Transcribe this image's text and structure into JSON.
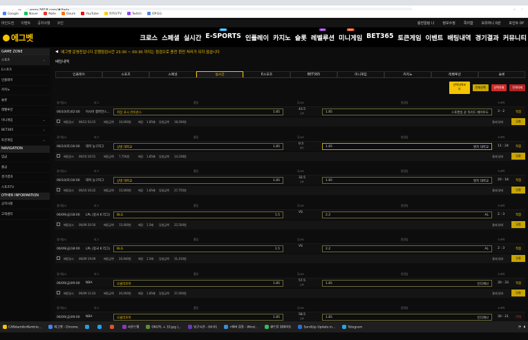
{
  "browser": {
    "url": "eggs-3818.com/#/bets",
    "bookmarks": [
      "Google",
      "Naver",
      "Nate",
      "Daum",
      "YouTube",
      "카카오TV",
      "Twitch",
      "OP.GG"
    ]
  },
  "topbar": {
    "left": [
      "마인드컨",
      "이벤트",
      "공지사항",
      "코인"
    ],
    "right": [
      "충전알림 나",
      "정보수정",
      "쪽지함",
      "보유머니 0원",
      "포인트 0P"
    ]
  },
  "header": {
    "logo": "에그벳",
    "nav": [
      {
        "label": "크로스",
        "badge": ""
      },
      {
        "label": "스페셜",
        "badge": ""
      },
      {
        "label": "실시간",
        "badge": ""
      },
      {
        "label": "E-SPORTS",
        "badge": "NEW"
      },
      {
        "label": "인플레이",
        "badge": ""
      },
      {
        "label": "카지노",
        "badge": ""
      },
      {
        "label": "슬롯",
        "badge": ""
      },
      {
        "label": "레벨루션",
        "badge": "HOT"
      },
      {
        "label": "미니게임",
        "badge": "HOT"
      },
      {
        "label": "BET365",
        "badge": ""
      },
      {
        "label": "토큰게임",
        "badge": ""
      },
      {
        "label": "이벤트",
        "badge": ""
      },
      {
        "label": "배팅내역",
        "badge": ""
      },
      {
        "label": "경기결과",
        "badge": ""
      },
      {
        "label": "커뮤니티",
        "badge": ""
      }
    ]
  },
  "sidebar": {
    "game_zone": "GAME ZONE",
    "games": [
      {
        "label": "스포츠",
        "arrow": "⌄"
      },
      {
        "label": "E스포츠",
        "arrow": ""
      },
      {
        "label": "인플레이",
        "arrow": ""
      },
      {
        "label": "카지노",
        "arrow": ""
      },
      {
        "label": "슬롯",
        "arrow": ""
      },
      {
        "label": "레벨루션",
        "arrow": ""
      },
      {
        "label": "미니게임",
        "arrow": "⌄"
      },
      {
        "label": "BET365",
        "arrow": "⌄"
      },
      {
        "label": "토큰게임",
        "arrow": "⌄"
      }
    ],
    "navigation": "NAVIGATION",
    "nav_items": [
      "입금",
      "출금",
      "경기결과",
      "스포츠TV"
    ],
    "other": "OTHER INFORMATION",
    "other_items": [
      "공지사항",
      "고객센터"
    ]
  },
  "notice": "에그벳 운영진입니다 은행점검시간 23:30 ~ 00:30 까지는 점검으로 충전 환전 처리가 되지 않습니다",
  "page_title": "배팅내역",
  "subtabs": [
    "인플레이",
    "스포츠",
    "스페셜",
    "실시간",
    "E스포츠",
    "BET365",
    "미니게임",
    "카지노",
    "레벨루션",
    "슬롯"
  ],
  "active_subtab": 3,
  "actions": [
    "선택내역보 부",
    "전체선택",
    "선택삭제",
    "전체삭제"
  ],
  "headers": {
    "time": "경기일시",
    "league": "리그",
    "home": "홈팀",
    "vs": "무/VS",
    "away": "원정팀",
    "score": "스코어"
  },
  "footer_labels": {
    "bet_time": "배팅일시",
    "bet_amount": "배팅금액",
    "odds": "배당",
    "win_amount": "당첨금액",
    "result": "결과/상태",
    "action": "당첨"
  },
  "bets": [
    {
      "time": "06/10(토)02:00",
      "league": "아시아 챔피언스...",
      "home": "저장 포시 라이온스",
      "home_odds": "1.85",
      "vs": "43.5",
      "vs_sub": "오버",
      "away_odds": "1.85",
      "away": "스포캔일 윤 타이드 베이투도",
      "score": "3 : 2",
      "result": "적중",
      "bet_time": "06/12 03:15",
      "amount": "10,000원",
      "odds": "1.85배",
      "win": "18,500원",
      "status": "결과/상태",
      "btn": "당첨"
    },
    {
      "time": "06/10(토)16:00",
      "league": "대학 농구리그",
      "home": "상명 대학교",
      "home_odds": "1.85",
      "vs": "0.5",
      "vs_sub": "핸디",
      "away_odds": "1.85",
      "away": "명지 대학교",
      "score": "11 : 24",
      "result": "적중",
      "bet_time": "06/10 16:51",
      "amount": "7,750원",
      "odds": "1.85배",
      "win": "14,338원",
      "status": "결과/상태",
      "btn": "당첨"
    },
    {
      "time": "06/10(토)16:00",
      "league": "대학 농구리그",
      "home": "상명 대학교",
      "home_odds": "1.85",
      "vs": "32.5",
      "vs_sub": "오버",
      "away_odds": "1.85",
      "away": "명지 대학교",
      "score": "20 : 18",
      "result": "적중",
      "bet_time": "06/10 16:22",
      "amount": "15,000원",
      "odds": "1.85배",
      "win": "27,750원",
      "status": "결과/상태",
      "btn": "당첨"
    },
    {
      "time": "06/09(금)18:00",
      "league": "LPL (중국 K 리그)",
      "home": "BLG",
      "home_odds": "1.5",
      "vs": "VS",
      "vs_sub": "",
      "away_odds": "2.2",
      "away": "AL",
      "score": "2 : 3",
      "result": "적중",
      "bet_time": "06/09 20:50",
      "amount": "15,000원",
      "odds": "1.5배",
      "win": "22,500원",
      "status": "결과/상태",
      "btn": "당첨"
    },
    {
      "time": "06/09(금)18:00",
      "league": "LPL (중국 K 리그)",
      "home": "BLG",
      "home_odds": "1.5",
      "vs": "VS",
      "vs_sub": "",
      "away_odds": "2.2",
      "away": "AL",
      "score": "2 : 3",
      "result": "적중",
      "bet_time": "06/09 19:09",
      "amount": "20,940원",
      "odds": "1.5배",
      "win": "31,410원",
      "status": "결과/상태",
      "btn": "당첨"
    },
    {
      "time": "06/09(금)09:00",
      "league": "NBA",
      "home": "오클라호마",
      "home_odds": "1.85",
      "vs": "57.5",
      "vs_sub": "오버",
      "away_odds": "1.85",
      "away": "인디애나",
      "score": "30 : 33",
      "result": "적중",
      "bet_time": "06/09 11:03",
      "amount": "20,000원",
      "odds": "1.85배",
      "win": "37,000원",
      "status": "결과/상태",
      "btn": "당첨"
    },
    {
      "time": "06/09(금)09:00",
      "league": "NBA",
      "home": "오클라호마",
      "home_odds": "1.85",
      "vs": "58.5",
      "vs_sub": "오버",
      "away_odds": "1.85",
      "away": "인디애나",
      "score": "30 : 21",
      "result": "미적",
      "bet_time": "",
      "amount": "",
      "odds": "",
      "win": "",
      "status": "",
      "btn": ""
    }
  ],
  "taskbar": [
    "CANdamtknf&mtrie...",
    "에그벳 - Chrome",
    "",
    "",
    "",
    "에그벳",
    "",
    "",
    "사운드랩",
    "",
    "OKUTL + 33.jpg |...",
    "",
    "당근시간 - 04:01",
    "",
    "•에버 검증 - Wind...",
    "",
    "랜드킹 업데이트",
    "",
    "SandLtp Update in...",
    "",
    "Telegram"
  ]
}
